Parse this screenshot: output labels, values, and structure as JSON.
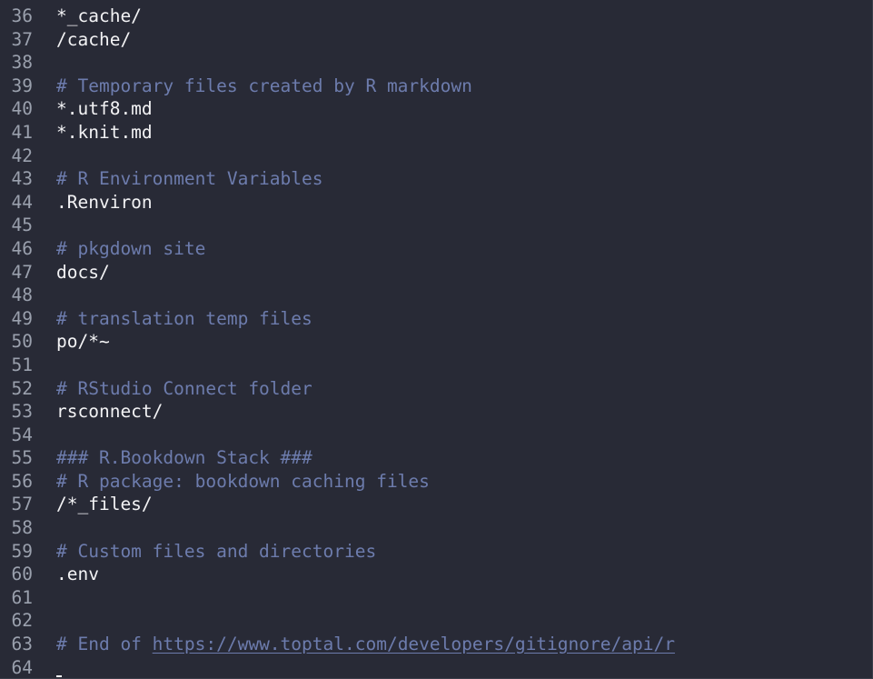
{
  "editor": {
    "lines": [
      {
        "n": "36",
        "type": "plain",
        "text": "*_cache/"
      },
      {
        "n": "37",
        "type": "plain",
        "text": "/cache/"
      },
      {
        "n": "38",
        "type": "blank",
        "text": ""
      },
      {
        "n": "39",
        "type": "comment",
        "text": "# Temporary files created by R markdown"
      },
      {
        "n": "40",
        "type": "plain",
        "text": "*.utf8.md"
      },
      {
        "n": "41",
        "type": "plain",
        "text": "*.knit.md"
      },
      {
        "n": "42",
        "type": "blank",
        "text": ""
      },
      {
        "n": "43",
        "type": "comment",
        "text": "# R Environment Variables"
      },
      {
        "n": "44",
        "type": "plain",
        "text": ".Renviron"
      },
      {
        "n": "45",
        "type": "blank",
        "text": ""
      },
      {
        "n": "46",
        "type": "comment",
        "text": "# pkgdown site"
      },
      {
        "n": "47",
        "type": "plain",
        "text": "docs/"
      },
      {
        "n": "48",
        "type": "blank",
        "text": ""
      },
      {
        "n": "49",
        "type": "comment",
        "text": "# translation temp files"
      },
      {
        "n": "50",
        "type": "plain",
        "text": "po/*~"
      },
      {
        "n": "51",
        "type": "blank",
        "text": ""
      },
      {
        "n": "52",
        "type": "comment",
        "text": "# RStudio Connect folder"
      },
      {
        "n": "53",
        "type": "plain",
        "text": "rsconnect/"
      },
      {
        "n": "54",
        "type": "blank",
        "text": ""
      },
      {
        "n": "55",
        "type": "comment",
        "text": "### R.Bookdown Stack ###"
      },
      {
        "n": "56",
        "type": "comment",
        "text": "# R package: bookdown caching files"
      },
      {
        "n": "57",
        "type": "plain",
        "text": "/*_files/"
      },
      {
        "n": "58",
        "type": "blank",
        "text": ""
      },
      {
        "n": "59",
        "type": "comment",
        "text": "# Custom files and directories"
      },
      {
        "n": "60",
        "type": "plain",
        "text": ".env"
      },
      {
        "n": "61",
        "type": "blank",
        "text": ""
      },
      {
        "n": "62",
        "type": "blank",
        "text": ""
      },
      {
        "n": "63",
        "type": "link",
        "prefix": "# End of ",
        "text": "https://www.toptal.com/developers/gitignore/api/r"
      },
      {
        "n": "64",
        "type": "blank",
        "text": ""
      }
    ]
  },
  "colors": {
    "background": "#282a36",
    "line_number": "#9aa0ad",
    "plain_text": "#f3f3f5",
    "comment": "#6d7cad"
  }
}
